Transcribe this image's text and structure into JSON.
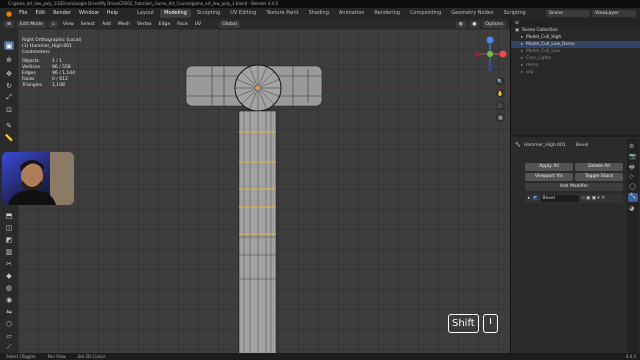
{
  "app": {
    "window_title": "C:\\game_art_low_poly_1\\GDrive\\Google Drive\\My Drive\\CR002_Tutorials\\_Game_Art_Course\\game_art_low_poly_1.blend - Blender 4.4.0",
    "menus": [
      "File",
      "Edit",
      "Render",
      "Window",
      "Help"
    ],
    "workspaces": [
      "Layout",
      "Modeling",
      "Sculpting",
      "UV Editing",
      "Texture Paint",
      "Shading",
      "Animation",
      "Rendering",
      "Compositing",
      "Geometry Nodes",
      "Scripting"
    ],
    "active_workspace": "Modeling",
    "scene": "Scene",
    "view_layer": "ViewLayer"
  },
  "viewport_header": {
    "mode": "Edit Mode",
    "menus": [
      "View",
      "Select",
      "Add",
      "Mesh",
      "Vertex",
      "Edge",
      "Face",
      "UV"
    ],
    "orientation": "Global",
    "options": "Options"
  },
  "viewport_info": {
    "view": "Right Orthographic (Local)",
    "object": "(1) Hammer_High.001",
    "units": "Centimeters",
    "stats": [
      {
        "label": "Objects",
        "value": "1 / 1"
      },
      {
        "label": "Vertices",
        "value": "96 / 558"
      },
      {
        "label": "Edges",
        "value": "96 / 1,144"
      },
      {
        "label": "Faces",
        "value": "0 / 612"
      },
      {
        "label": "Triangles",
        "value": "1,108"
      }
    ]
  },
  "key_hint": {
    "key": "Shift"
  },
  "outliner": {
    "title": "Scene Collection",
    "items": [
      {
        "name": "Scene Collection"
      },
      {
        "name": "Model_Coll_High"
      },
      {
        "name": "Model_Coll_Low_Demo"
      },
      {
        "name": "Model_Coll_Low"
      },
      {
        "name": "Cam_Lights"
      },
      {
        "name": "demo"
      },
      {
        "name": "wip"
      }
    ]
  },
  "properties": {
    "object": "Hammer_High.001",
    "modifier_tab": "Bevel",
    "apply_all": "Apply All",
    "delete_all": "Delete All",
    "viewport_vis": "Viewport Vis",
    "toggle_stack": "Toggle Stack",
    "add_modifier": "Add Modifier",
    "modifier_name": "Bevel"
  },
  "statusbar": {
    "items": [
      "Select (Toggle)",
      "Pan View",
      "Set 3D Cursor"
    ],
    "version": "4.4.0"
  }
}
